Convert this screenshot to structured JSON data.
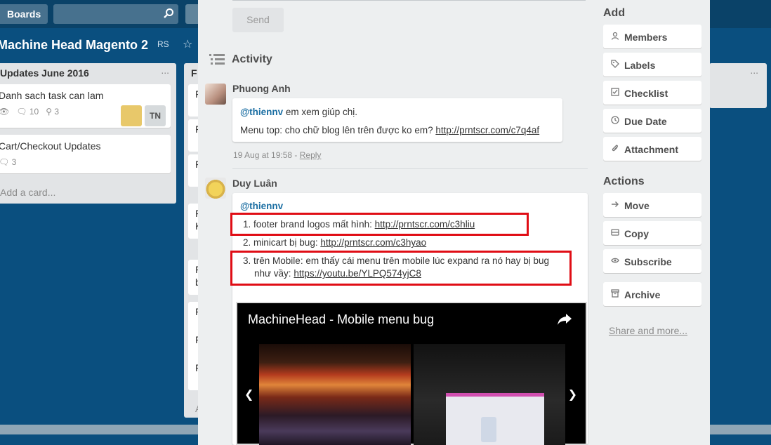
{
  "header": {
    "boards_label": "Boards",
    "search_placeholder": ""
  },
  "board": {
    "title": "Machine Head Magento 2",
    "badge": "RS",
    "lists": [
      {
        "title": "Updates June 2016",
        "menu": "...",
        "cards": [
          {
            "title": "Danh sach task can lam",
            "comments": "10",
            "attachments": "3",
            "member_initials": "TN"
          },
          {
            "title": "Cart/Checkout Updates",
            "comments": "3"
          }
        ],
        "add_card": "Add a card..."
      },
      {
        "title": "F",
        "stubs": [
          "F",
          "F",
          "F",
          "F",
          "K",
          "F",
          "b",
          "F",
          "F",
          "F",
          "A"
        ]
      },
      {
        "title": "",
        "menu": "..."
      }
    ]
  },
  "modal": {
    "send_label": "Send",
    "activity_title": "Activity",
    "comments": [
      {
        "author": "Phuong Anh",
        "mention": "@thiennv",
        "line1_text": " em xem giúp chị.",
        "line2_text": "Menu top: cho chữ blog lên trên được ko em? ",
        "line2_link": "http://prntscr.com/c7q4af",
        "timestamp": "19 Aug at 19:58",
        "separator": " - ",
        "reply_label": "Reply"
      },
      {
        "author": "Duy Luân",
        "mention": "@thiennv",
        "items": [
          {
            "number": "1.",
            "text": "footer brand logos mất hình: ",
            "link": "http://prntscr.com/c3hliu"
          },
          {
            "number": "2.",
            "text": "minicart bị bug: ",
            "link": "http://prntscr.com/c3hyao"
          },
          {
            "number": "3.",
            "text": "trên Mobile: em thấy cái menu trên mobile lúc expand ra nó hay bị bug",
            "text2": "như vầy: ",
            "link": "https://youtu.be/YLPQ574yjC8"
          }
        ],
        "video": {
          "title": "MachineHead - Mobile menu bug"
        }
      }
    ]
  },
  "sidebar": {
    "add_heading": "Add",
    "add_buttons": [
      {
        "label": "Members",
        "icon": "person-icon"
      },
      {
        "label": "Labels",
        "icon": "tag-icon"
      },
      {
        "label": "Checklist",
        "icon": "checkbox-icon"
      },
      {
        "label": "Due Date",
        "icon": "clock-icon"
      },
      {
        "label": "Attachment",
        "icon": "paperclip-icon"
      }
    ],
    "actions_heading": "Actions",
    "action_buttons": [
      {
        "label": "Move",
        "icon": "arrow-right-icon"
      },
      {
        "label": "Copy",
        "icon": "copy-icon"
      },
      {
        "label": "Subscribe",
        "icon": "eye-icon"
      },
      {
        "label": "Archive",
        "icon": "archive-icon"
      }
    ],
    "share_more": "Share and more..."
  }
}
